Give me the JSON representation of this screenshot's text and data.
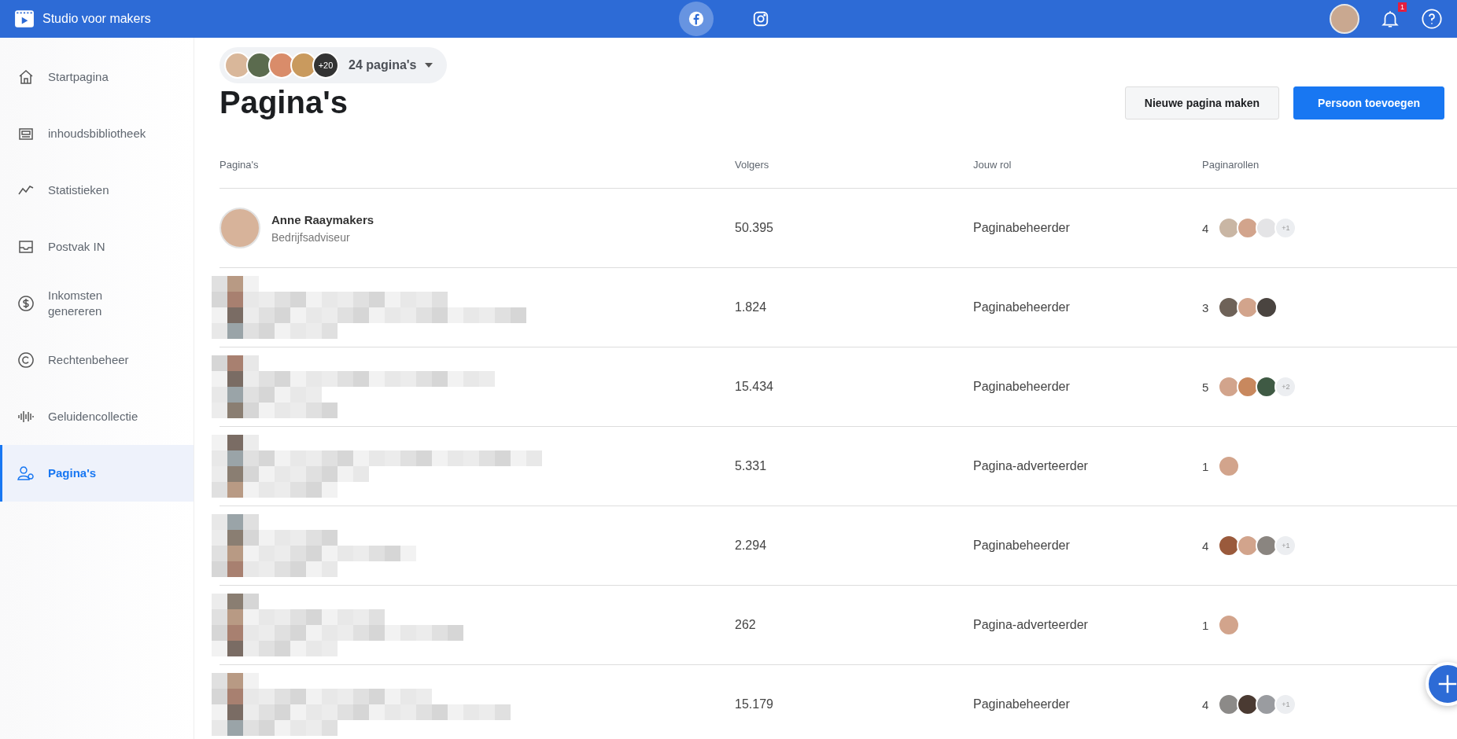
{
  "topbar": {
    "title": "Studio voor makers",
    "platforms": [
      {
        "selected": true
      },
      {
        "selected": false
      }
    ],
    "notifications": "1"
  },
  "sidebar": {
    "items": [
      {
        "label": "Startpagina",
        "selected": false
      },
      {
        "label": "inhoudsbibliotheek",
        "selected": false
      },
      {
        "label": "Statistieken",
        "selected": false
      },
      {
        "label": "Postvak IN",
        "selected": false
      },
      {
        "label": "Inkomsten genereren",
        "selected": false
      },
      {
        "label": "Rechtenbeheer",
        "selected": false
      },
      {
        "label": "Geluidencollectie",
        "selected": false
      },
      {
        "label": "Pagina's",
        "selected": true
      }
    ]
  },
  "page_switcher": {
    "avatars": [
      {
        "color": "#d9b79a"
      },
      {
        "color": "#5b6b4e"
      },
      {
        "color": "#d98c6a"
      },
      {
        "color": "#c99a5e"
      }
    ],
    "more": "+20",
    "label": "24 pagina's"
  },
  "title": "Pagina's",
  "buttons": [
    {
      "label": "Nieuwe pagina maken",
      "kind": "secondary"
    },
    {
      "label": "Persoon toevoegen",
      "kind": "primary"
    }
  ],
  "table": {
    "columns": [
      "Pagina's",
      "Volgers",
      "Jouw rol",
      "Paginarollen"
    ],
    "rows": [
      {
        "kind": "visible",
        "name": "Anne Raaymakers",
        "subtitle": "Bedrijfsadviseur",
        "followers": "50.395",
        "role": "Paginabeheerder",
        "role_count": "4",
        "avatars": [
          {
            "color": "#c9b6a4"
          },
          {
            "color": "#d2a48c"
          },
          {
            "color": "#e4e4e6"
          }
        ],
        "more": "+1"
      },
      {
        "kind": "pixelated",
        "followers": "1.824",
        "role": "Paginabeheerder",
        "role_count": "3",
        "avatars": [
          {
            "color": "#6e6258"
          },
          {
            "color": "#d2a48c"
          },
          {
            "color": "#4a4440"
          }
        ]
      },
      {
        "kind": "pixelated",
        "followers": "15.434",
        "role": "Paginabeheerder",
        "role_count": "5",
        "avatars": [
          {
            "color": "#d2a48c"
          },
          {
            "color": "#c8885e"
          },
          {
            "color": "#3f5a44"
          }
        ],
        "more": "+2"
      },
      {
        "kind": "pixelated",
        "followers": "5.331",
        "role": "Pagina-adverteerder",
        "role_count": "1",
        "avatars": [
          {
            "color": "#d2a48c"
          }
        ]
      },
      {
        "kind": "pixelated",
        "followers": "2.294",
        "role": "Paginabeheerder",
        "role_count": "4",
        "avatars": [
          {
            "color": "#9a5a3c"
          },
          {
            "color": "#d2a48c"
          },
          {
            "color": "#8a8580"
          }
        ],
        "more": "+1"
      },
      {
        "kind": "pixelated",
        "followers": "262",
        "role": "Pagina-adverteerder",
        "role_count": "1",
        "avatars": [
          {
            "color": "#d2a48c"
          }
        ]
      },
      {
        "kind": "pixelated",
        "followers": "15.179",
        "role": "Paginabeheerder",
        "role_count": "4",
        "avatars": [
          {
            "color": "#8c8a88"
          },
          {
            "color": "#4a3a32"
          },
          {
            "color": "#9a9ca0"
          }
        ],
        "more": "+1"
      }
    ]
  }
}
